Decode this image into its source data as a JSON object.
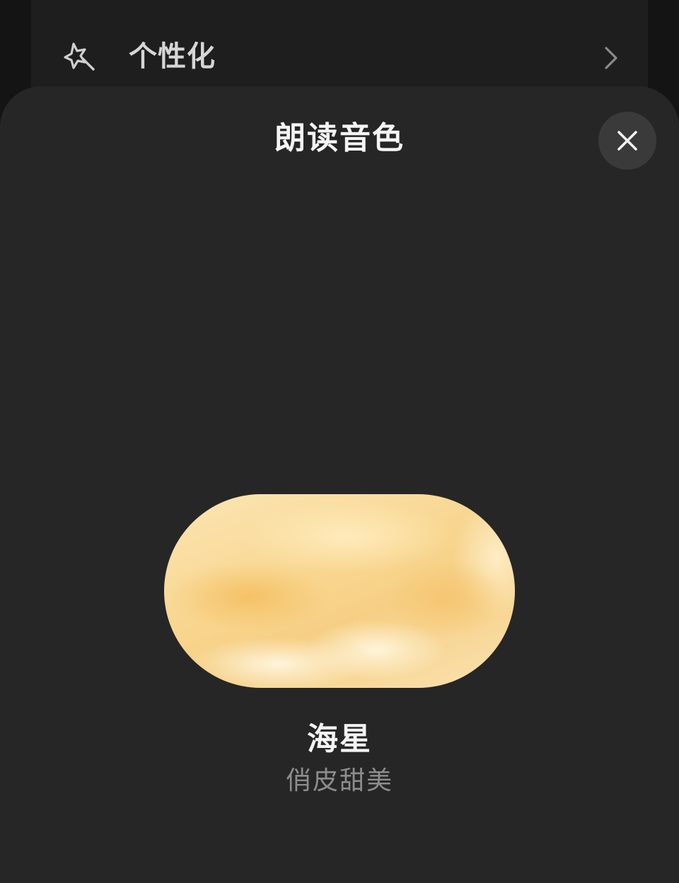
{
  "background_page": {
    "settings_row": {
      "label": "个性化",
      "icon": "sparkle-icon",
      "chevron": "chevron-right-icon"
    }
  },
  "sheet": {
    "title": "朗读音色",
    "close_icon": "close-icon"
  },
  "voice": {
    "name": "海星",
    "description": "俏皮甜美",
    "accent_colors": [
      "#f8d58e",
      "#fbe6b4",
      "#fff6de"
    ]
  },
  "colors": {
    "sheet_background": "#262627",
    "page_background": "#141414",
    "close_button_background": "#3a3a3b"
  }
}
